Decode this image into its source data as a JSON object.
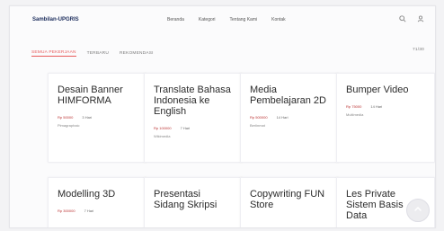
{
  "header": {
    "logo": "Sambilan-UPGRIS",
    "nav": [
      "Beranda",
      "Kategori",
      "Tentang Kami",
      "Kontak"
    ],
    "icons": [
      "search-icon",
      "user-icon"
    ]
  },
  "tabs": {
    "items": [
      "SEMUA PEKERJAAN",
      "TERBARU",
      "REKOMENDASI"
    ],
    "active_index": 0,
    "count": "71/30"
  },
  "cards": [
    {
      "title": "Desain Banner HIMFORMA",
      "price": "Rp 50000",
      "time": "3 Hari",
      "sub": "Pimagraphaic"
    },
    {
      "title": "Translate Bahasa Indonesia ke English",
      "price": "Rp 100000",
      "time": "7 Hari",
      "sub": "Wikimedia"
    },
    {
      "title": "Media Pembelajaran 2D",
      "price": "Rp 500000",
      "time": "14 Hari",
      "sub": "Berlinmat"
    },
    {
      "title": "Bumper Video",
      "price": "Rp 75000",
      "time": "14 Hari",
      "sub": "Multimedia"
    },
    {
      "title": "Modelling 3D",
      "price": "Rp 300000",
      "time": "7 Hari",
      "sub": ""
    },
    {
      "title": "Presentasi Sidang Skripsi",
      "price": "",
      "time": "",
      "sub": ""
    },
    {
      "title": "Copywriting FUN Store",
      "price": "",
      "time": "",
      "sub": ""
    },
    {
      "title": "Les Private Sistem Basis Data",
      "price": "",
      "time": "",
      "sub": ""
    }
  ],
  "scroll_button": {
    "icon": "chevron-up-icon"
  },
  "colors": {
    "accent": "#e85a5a",
    "text_dark": "#2b2b2b",
    "logo": "#1b2c5c"
  }
}
